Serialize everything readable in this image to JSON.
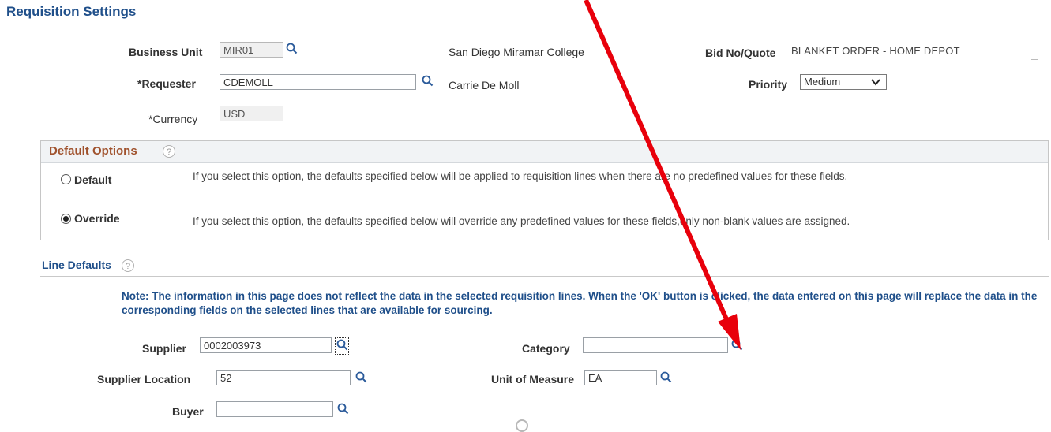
{
  "page": {
    "title": "Requisition Settings"
  },
  "header": {
    "business_unit": {
      "label": "Business Unit",
      "value": "MIR01",
      "description": "San Diego Miramar College"
    },
    "requester": {
      "label": "*Requester",
      "value": "CDEMOLL",
      "description": "Carrie De Moll"
    },
    "currency": {
      "label": "*Currency",
      "value": "USD"
    },
    "bid_no_quote": {
      "label": "Bid No/Quote",
      "value": "BLANKET ORDER - HOME DEPOT"
    },
    "priority": {
      "label": "Priority",
      "value": "Medium"
    }
  },
  "default_options": {
    "title": "Default Options",
    "help": "?",
    "options": [
      {
        "label": "Default",
        "selected": false,
        "description": "If you select this option, the defaults specified below will be applied to requisition lines when there are no predefined values for these fields."
      },
      {
        "label": "Override",
        "selected": true,
        "description": "If you select this option, the defaults specified below will override any predefined values for these fields,only non-blank values are assigned."
      }
    ]
  },
  "line_defaults": {
    "title": "Line Defaults",
    "help": "?",
    "note_prefix": "Note:",
    "note_text": " The information in this page does not reflect the data in the selected requisition lines. When the 'OK' button is clicked, the data entered on this page will replace the data in the corresponding fields on the selected lines that are available for sourcing.",
    "supplier": {
      "label": "Supplier",
      "value": "0002003973"
    },
    "supplier_location": {
      "label": "Supplier Location",
      "value": "52"
    },
    "buyer": {
      "label": "Buyer",
      "value": ""
    },
    "category": {
      "label": "Category",
      "value": ""
    },
    "unit_of_measure": {
      "label": "Unit of Measure",
      "value": "EA"
    }
  },
  "annotation": {
    "arrow_color": "#e8000b"
  },
  "icons": [
    "search-icon",
    "help-icon",
    "chevron-down-icon"
  ]
}
